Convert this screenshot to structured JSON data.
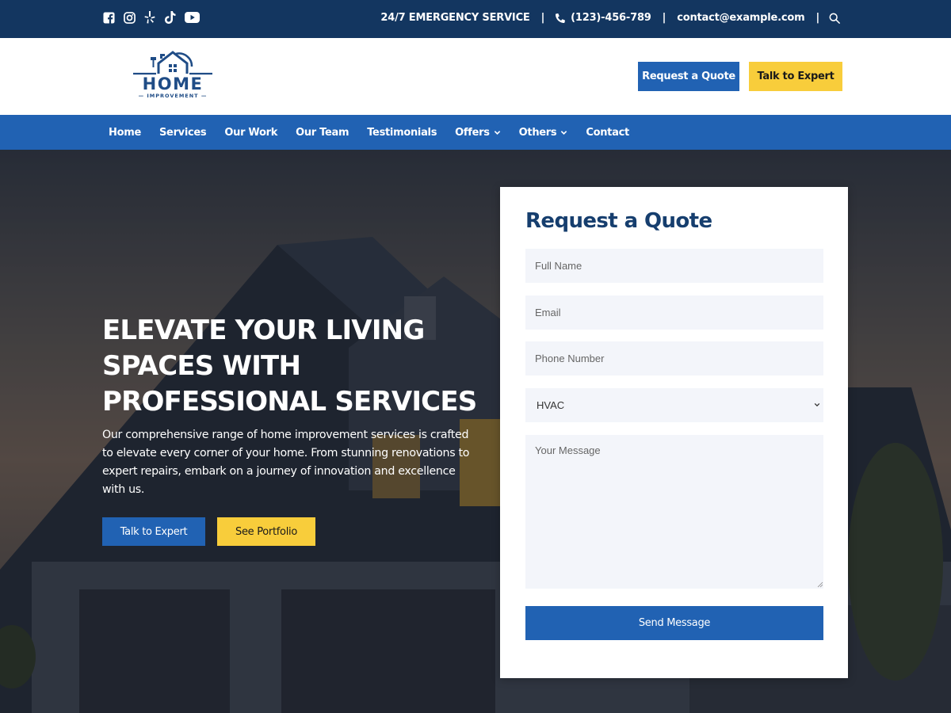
{
  "topbar": {
    "social_icons": [
      "facebook-icon",
      "instagram-icon",
      "yelp-icon",
      "tiktok-icon",
      "youtube-icon"
    ],
    "emergency": "24/7 EMERGENCY SERVICE",
    "phone": "(123)-456-789",
    "email": "contact@example.com"
  },
  "logo": {
    "title": "HOME",
    "subtitle": "IMPROVEMENT"
  },
  "header": {
    "quote_button": "Request a Quote",
    "expert_button": "Talk to Expert"
  },
  "nav": {
    "items": [
      {
        "label": "Home"
      },
      {
        "label": "Services"
      },
      {
        "label": "Our Work"
      },
      {
        "label": "Our Team"
      },
      {
        "label": "Testimonials"
      },
      {
        "label": "Offers",
        "dropdown": true
      },
      {
        "label": "Others",
        "dropdown": true
      },
      {
        "label": "Contact"
      }
    ]
  },
  "hero": {
    "title_lines": [
      "ELEVATE YOUR LIVING",
      "SPACES WITH",
      "PROFESSIONAL SERVICES"
    ],
    "text": "Our comprehensive range of home improvement services is crafted to elevate every corner of your home. From stunning renovations to expert repairs, embark on a journey of innovation and excellence with us.",
    "expert_button": "Talk to Expert",
    "portfolio_button": "See Portfolio"
  },
  "form": {
    "title": "Request a Quote",
    "name_placeholder": "Full Name",
    "email_placeholder": "Email",
    "phone_placeholder": "Phone Number",
    "service_selected": "HVAC",
    "message_placeholder": "Your Message",
    "submit": "Send Message"
  },
  "colors": {
    "topbar": "#133660",
    "primary": "#2162b3",
    "accent": "#f8cd3b",
    "heading": "#163e6e",
    "field_bg": "#f3f5fa"
  }
}
